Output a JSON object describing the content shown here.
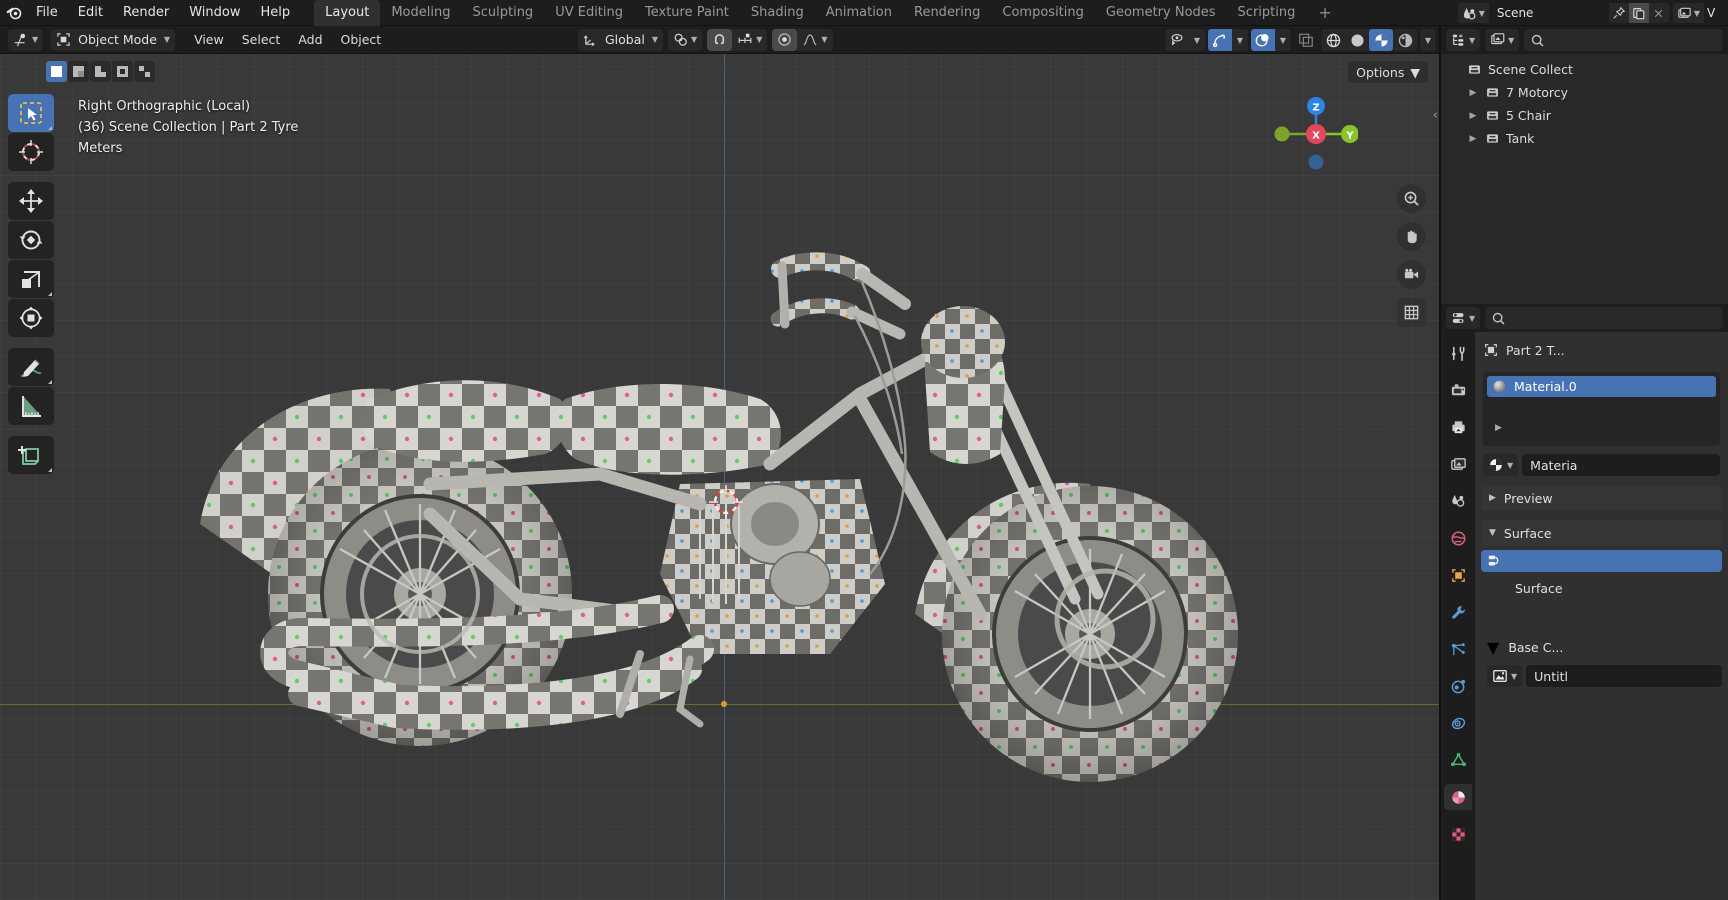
{
  "app": {
    "name": "Blender",
    "logo_icon": "blender-logo-icon"
  },
  "topbar": {
    "menus": [
      "File",
      "Edit",
      "Render",
      "Window",
      "Help"
    ],
    "workspace_tabs": [
      {
        "label": "Layout",
        "active": true
      },
      {
        "label": "Modeling",
        "active": false
      },
      {
        "label": "Sculpting",
        "active": false
      },
      {
        "label": "UV Editing",
        "active": false
      },
      {
        "label": "Texture Paint",
        "active": false
      },
      {
        "label": "Shading",
        "active": false
      },
      {
        "label": "Animation",
        "active": false
      },
      {
        "label": "Rendering",
        "active": false
      },
      {
        "label": "Compositing",
        "active": false
      },
      {
        "label": "Geometry Nodes",
        "active": false
      },
      {
        "label": "Scripting",
        "active": false
      }
    ],
    "add_workspace_label": "+",
    "scene": {
      "browse_icon": "scene-browse-icon",
      "name": "Scene",
      "pin_icon": "pin-icon",
      "new_icon": "new-scene-icon",
      "delete_icon": "close-x-icon"
    },
    "view_layer": {
      "browse_icon": "view-layer-icon",
      "name": "V"
    }
  },
  "viewport_header": {
    "editor_type_icon": "editor-type-3dview-icon",
    "mode": {
      "icon": "object-mode-icon",
      "label": "Object Mode"
    },
    "menus": [
      "View",
      "Select",
      "Add",
      "Object"
    ],
    "transform_orientation": {
      "icon": "orientation-icon",
      "label": "Global"
    },
    "snap": {
      "pivot_icon": "pivot-point-icon",
      "magnet_icon": "snap-magnet-icon",
      "snap_to_icon": "snap-increment-icon",
      "magnet_active": true
    },
    "proportional": {
      "icon": "proportional-edit-icon",
      "falloff_icon": "falloff-curve-icon"
    },
    "right_controls": {
      "visibility_icon": "object-visibility-icon",
      "gizmo_icon": "gizmo-icon",
      "gizmo_active": true,
      "overlays_icon": "overlays-icon",
      "overlays_active": true,
      "xray_icon": "xray-toggle-icon",
      "shading_modes": [
        {
          "icon": "shading-wireframe-icon",
          "active": false
        },
        {
          "icon": "shading-solid-icon",
          "active": false
        },
        {
          "icon": "shading-material-preview-icon",
          "active": true
        },
        {
          "icon": "shading-rendered-icon",
          "active": false
        }
      ],
      "shading_dropdown_icon": "chevron-down-icon"
    }
  },
  "viewport": {
    "select_modes": [
      {
        "icon": "select-box-icon",
        "active": true
      },
      {
        "icon": "select-extend-icon",
        "active": false
      },
      {
        "icon": "select-subtract-icon",
        "active": false
      },
      {
        "icon": "select-invert-icon",
        "active": false
      },
      {
        "icon": "select-intersect-icon",
        "active": false
      }
    ],
    "options_label": "Options",
    "overlay_text": {
      "line1": "Right Orthographic (Local)",
      "line2": "(36) Scene Collection | Part 2 Tyre",
      "line3": "Meters"
    },
    "toolbar": [
      {
        "icon": "tweak-select-box-icon",
        "active": true
      },
      {
        "icon": "cursor-icon",
        "active": false
      },
      {
        "icon": "move-icon",
        "active": false
      },
      {
        "icon": "rotate-icon",
        "active": false
      },
      {
        "icon": "scale-icon",
        "active": false
      },
      {
        "icon": "transform-icon",
        "active": false
      },
      {
        "icon": "annotate-icon",
        "active": false
      },
      {
        "icon": "measure-icon",
        "active": false
      },
      {
        "icon": "add-cube-icon",
        "active": false
      }
    ],
    "nav_gizmo": {
      "axis_z_label": "Z",
      "axis_y_label": "Y",
      "axis_x_label": "X",
      "colors": {
        "z": "#2f83e3",
        "y": "#8bc42a",
        "x": "#e0485c"
      }
    },
    "nav_buttons": [
      {
        "icon": "zoom-icon"
      },
      {
        "icon": "pan-hand-icon"
      },
      {
        "icon": "camera-view-icon"
      },
      {
        "icon": "toggle-orthographic-icon"
      }
    ],
    "collapse_arrow_icon": "sidebar-collapse-icon",
    "grid_color": "#393939",
    "z_axis_color": "#3e6a9b",
    "y_axis_color": "#5c7c35",
    "model": {
      "name": "Motorcycle",
      "description": "Checker-textured motorcycle mesh, right orthographic view"
    }
  },
  "outliner": {
    "display_mode_icon": "outliner-display-mode-icon",
    "filter_icon": "outliner-filter-icon",
    "search_icon": "search-icon",
    "rows": [
      {
        "label": "Scene Collect",
        "icon": "collection-icon",
        "indent": 0,
        "expandable": false
      },
      {
        "label": "7 Motorcy",
        "icon": "collection-icon",
        "indent": 1,
        "expandable": true
      },
      {
        "label": "5 Chair",
        "icon": "collection-icon",
        "indent": 1,
        "expandable": true
      },
      {
        "label": "Tank",
        "icon": "collection-icon",
        "indent": 1,
        "expandable": true
      }
    ]
  },
  "properties": {
    "editor_type_icon": "properties-editor-icon",
    "search_icon": "search-icon",
    "tabs": [
      {
        "icon": "tool-icon",
        "active": false,
        "color": "#c8c8c8"
      },
      {
        "icon": "render-icon",
        "active": false,
        "color": "#c8c8c8"
      },
      {
        "icon": "output-printer-icon",
        "active": false,
        "color": "#c8c8c8"
      },
      {
        "icon": "view-layer-icon",
        "active": false,
        "color": "#c8c8c8"
      },
      {
        "icon": "scene-icon",
        "active": false,
        "color": "#c8c8c8"
      },
      {
        "icon": "world-icon",
        "active": false,
        "color": "#d9607a"
      },
      {
        "icon": "object-icon",
        "active": false,
        "color": "#e5a34a"
      },
      {
        "icon": "modifier-wrench-icon",
        "active": false,
        "color": "#5a9bd8"
      },
      {
        "icon": "particles-icon",
        "active": false,
        "color": "#5a9bd8"
      },
      {
        "icon": "physics-icon",
        "active": false,
        "color": "#5a9bd8"
      },
      {
        "icon": "constraints-icon",
        "active": false,
        "color": "#5a9bd8"
      },
      {
        "icon": "object-data-mesh-icon",
        "active": false,
        "color": "#4cb87a"
      },
      {
        "icon": "material-icon",
        "active": true,
        "color": "#d9607a"
      },
      {
        "icon": "texture-checker-icon",
        "active": false,
        "color": "#d9607a"
      }
    ],
    "breadcrumb": {
      "object_icon": "object-icon",
      "object_name": "Part 2 T..."
    },
    "material_slot": {
      "preview_icon": "material-sphere-icon",
      "name": "Material.0",
      "expand_icon": "triangle-right-icon"
    },
    "material_browse": {
      "icon": "material-browse-icon",
      "name": "Materia"
    },
    "panels": [
      {
        "label": "Preview",
        "expanded": false,
        "chevron": "chevron-right-icon"
      },
      {
        "label": "Surface",
        "expanded": true,
        "chevron": "chevron-down-icon"
      }
    ],
    "surface": {
      "link_icon": "node-link-icon",
      "field_label": "Surface"
    },
    "base_color": {
      "chevron": "triangle-down-icon",
      "label": "Base C...",
      "texture_icon": "image-texture-icon",
      "texture_name": "Untitl"
    }
  },
  "colors": {
    "accent_blue": "#4772b3",
    "window_bg": "#1d1d1d",
    "panel_bg": "#303030",
    "viewport_bg": "#393939",
    "field_bg": "#282828",
    "text": "#dcdcdc"
  }
}
